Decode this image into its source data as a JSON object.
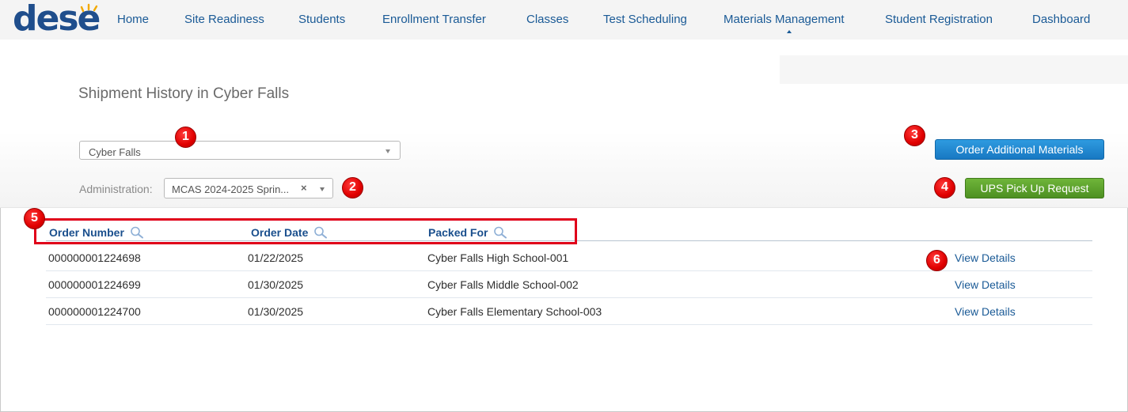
{
  "nav": {
    "logo": "dese",
    "items": [
      "Home",
      "Site Readiness",
      "Students",
      "Enrollment Transfer",
      "Classes",
      "Test Scheduling",
      "Materials Management",
      "Student Registration",
      "Dashboard"
    ],
    "active": "Materials Management"
  },
  "page": {
    "title": "Shipment History in Cyber Falls",
    "district_select": "Cyber Falls",
    "administration_label": "Administration:",
    "administration_value": "MCAS 2024-2025 Sprin...",
    "clear_symbol": "×"
  },
  "buttons": {
    "order_additional": "Order Additional Materials",
    "ups_pickup": "UPS Pick Up Request"
  },
  "table": {
    "columns": [
      "Order Number",
      "Order Date",
      "Packed For"
    ],
    "link_label": "View Details",
    "rows": [
      {
        "order_number": "000000001224698",
        "order_date": "01/22/2025",
        "packed_for": "Cyber Falls High School-001"
      },
      {
        "order_number": "000000001224699",
        "order_date": "01/30/2025",
        "packed_for": "Cyber Falls Middle School-002"
      },
      {
        "order_number": "000000001224700",
        "order_date": "01/30/2025",
        "packed_for": "Cyber Falls Elementary School-003"
      }
    ]
  },
  "annotations": [
    "1",
    "2",
    "3",
    "4",
    "5",
    "6"
  ],
  "colors": {
    "nav_link": "#1a5a96",
    "primary_button": "#1878c2",
    "success_button": "#4d9022",
    "annotation_red": "#e00000"
  },
  "icons": {
    "column_search": "search-icon",
    "select_caret": "chevron-down-icon"
  }
}
